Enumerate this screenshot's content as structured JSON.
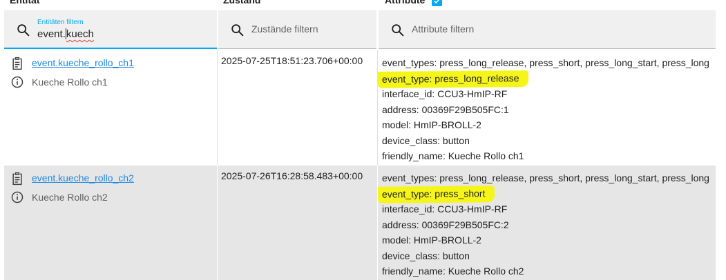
{
  "headers": {
    "entity": "Entität",
    "state": "Zustand",
    "attributes": "Attribute"
  },
  "filters": {
    "entity": {
      "floating_label": "Entitäten filtern",
      "value_plain": "event.",
      "value_squiggle": "kuech"
    },
    "state": {
      "placeholder": "Zustände filtern"
    },
    "attributes": {
      "placeholder": "Attribute filtern"
    }
  },
  "rows": [
    {
      "entity_id": "event.kueche_rollo_ch1",
      "friendly_name": "Kueche Rollo ch1",
      "state": "2025-07-25T18:51:23.706+00:00",
      "attributes": [
        "event_types: press_long_release, press_short, press_long_start, press_long",
        "event_type: press_long_release",
        "interface_id: CCU3-HmIP-RF",
        "address: 00369F29B505FC:1",
        "model: HmIP-BROLL-2",
        "device_class: button",
        "friendly_name: Kueche Rollo ch1"
      ]
    },
    {
      "entity_id": "event.kueche_rollo_ch2",
      "friendly_name": "Kueche Rollo ch2",
      "state": "2025-07-26T16:28:58.483+00:00",
      "attributes": [
        "event_types: press_long_release, press_short, press_long_start, press_long",
        "event_type: press_short",
        "interface_id: CCU3-HmIP-RF",
        "address: 00369F29B505FC:2",
        "model: HmIP-BROLL-2",
        "device_class: button",
        "friendly_name: Kueche Rollo ch2"
      ]
    }
  ],
  "colors": {
    "accent": "#03a9f4",
    "link": "#1e88e5",
    "highlight": "#f5f51a",
    "row_alt": "#e6e6e6"
  },
  "icons": {
    "search": "search-icon",
    "entity": "clipboard-list-icon",
    "info": "info-icon",
    "checkbox": "checkbox-checked-icon"
  }
}
